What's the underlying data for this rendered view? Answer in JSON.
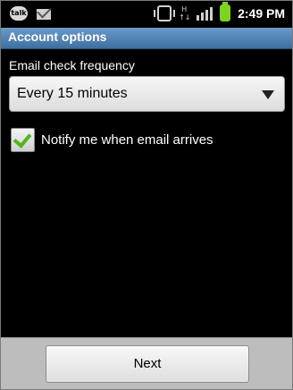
{
  "status_bar": {
    "time": "2:49 PM",
    "left_icons": [
      "talk-icon",
      "mail-icon"
    ],
    "right_icons": [
      "vibrate-icon",
      "hspa-icon",
      "signal-icon",
      "battery-icon"
    ],
    "talk_icon_text": "talk",
    "hspa_text": "H",
    "battery_color": "#7ed321"
  },
  "title_bar": {
    "title": "Account options",
    "color": "#4f82b5"
  },
  "form": {
    "frequency_label": "Email check frequency",
    "frequency_value": "Every 15 minutes",
    "notify_label": "Notify me when email arrives",
    "notify_checked": true,
    "check_color": "#52b51c"
  },
  "footer": {
    "next_label": "Next"
  }
}
